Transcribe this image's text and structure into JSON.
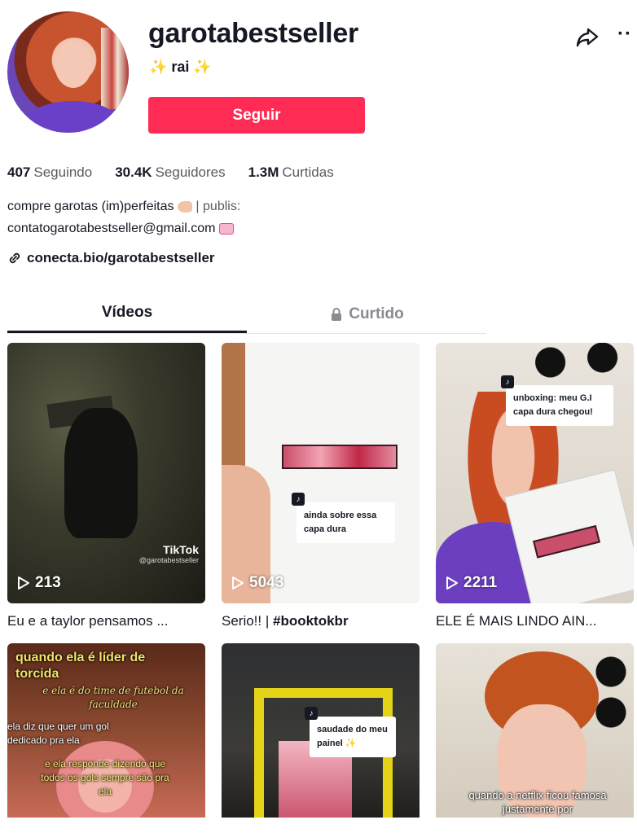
{
  "profile": {
    "username": "garotabestseller",
    "nickname": "✨ rai ✨",
    "follow_label": "Seguir"
  },
  "stats": [
    {
      "value": "407",
      "label": "Seguindo"
    },
    {
      "value": "30.4K",
      "label": "Seguidores"
    },
    {
      "value": "1.3M",
      "label": "Curtidas"
    }
  ],
  "bio": {
    "line1": "compre garotas (im)perfeitas",
    "line1b": "| publis:",
    "line2": "contatogarotabestseller@gmail.com"
  },
  "link": "conecta.bio/garotabestseller",
  "tabs": [
    {
      "label": "Vídeos"
    },
    {
      "label": "Curtido"
    }
  ],
  "videos": [
    {
      "views": "213",
      "caption": "Eu e a taylor pensamos ...",
      "watermark_brand": "TikTok",
      "watermark_handle": "@garotabestseller"
    },
    {
      "views": "5043",
      "caption_plain": "Serio!! | ",
      "caption_tag": "#booktokbr",
      "sticker": "ainda sobre essa capa dura"
    },
    {
      "views": "2211",
      "caption": "ELE É MAIS LINDO AIN...",
      "sticker": "unboxing: meu G.I capa dura chegou!"
    },
    {
      "overlay_title": "quando ela é líder de torcida",
      "overlay_sub": "e ela é do time de futebol da faculdade",
      "overlay_a": "ela diz que quer um gol dedicado pra ela",
      "overlay_b": "e ela responde dizendo que todos os gols sempre são pra ela"
    },
    {
      "sticker": "saudade do meu painel ✨"
    },
    {
      "overlay_bottom": "quando a netflix ficou famosa justamente por"
    }
  ],
  "colors": {
    "primary": "#fe2c55",
    "text": "#161823",
    "muted": "#5a5b62"
  }
}
